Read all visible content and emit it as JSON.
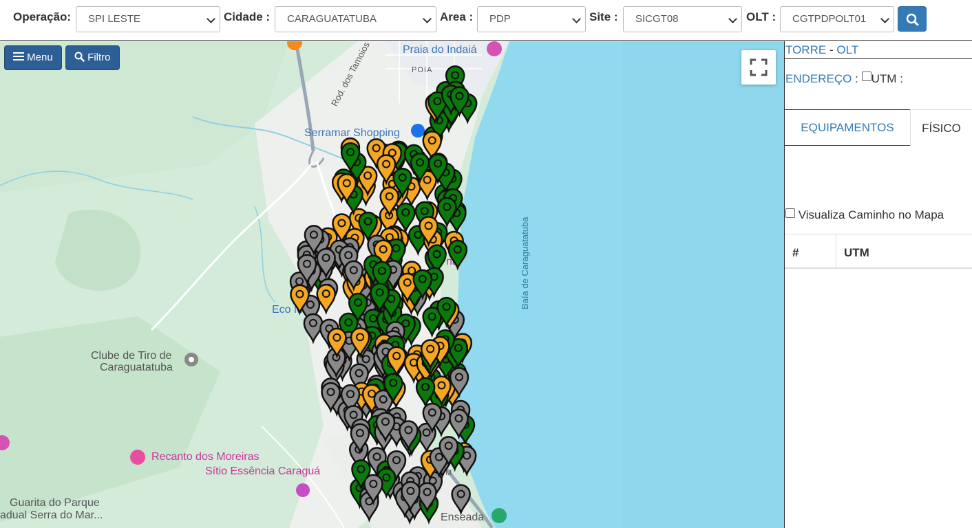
{
  "filters": {
    "operacao": {
      "label": "Operação:",
      "value": "SPI LESTE"
    },
    "cidade": {
      "label": "Cidade :",
      "value": "CARAGUATATUBA"
    },
    "area": {
      "label": "Area :",
      "value": "PDP"
    },
    "site": {
      "label": "Site :",
      "value": "SICGT08"
    },
    "olt": {
      "label": "OLT :",
      "value": "CGTPDPOLT01"
    }
  },
  "map_controls": {
    "menu_label": "Menu",
    "filtro_label": "Filtro"
  },
  "map_labels": {
    "praia_indaia": "Praia do Indaiá",
    "poia": "POIA",
    "rod_tamoios": "Rod. dos Tamoios",
    "serramar": "Serramar Shopping",
    "baia": "Baía de Caraguatatuba",
    "eco": "Eco M",
    "clube_tiro_1": "Clube de Tiro de",
    "clube_tiro_2": "Caraguatatuba",
    "recanto": "Recanto dos Moreiras",
    "sitio": "Sítio Essência Caraguá",
    "guarita_1": "Guarita do Parque",
    "guarita_2": "adual Serra do Mar...",
    "enseada": "Enseada",
    "irim": "IRIM",
    "na": "na"
  },
  "panel": {
    "torre": "TORRE",
    "sep": "-",
    "olt": "OLT",
    "endereco": "ENDEREÇO",
    "colon": ":",
    "utm_label": "UTM :",
    "tabs": [
      "EQUIPAMENTOS",
      "FÍSICO"
    ],
    "caminho_label": "Visualiza Caminho no Mapa",
    "table_headers": [
      "#",
      "UTM"
    ]
  },
  "marker_colors": {
    "green": "#0a7a0a",
    "orange": "#f5a623",
    "gray": "#8a8a8a"
  },
  "icons": {
    "menu": "menu-icon",
    "filtro": "search-icon",
    "fullscreen": "fullscreen-icon",
    "search": "search-icon"
  }
}
